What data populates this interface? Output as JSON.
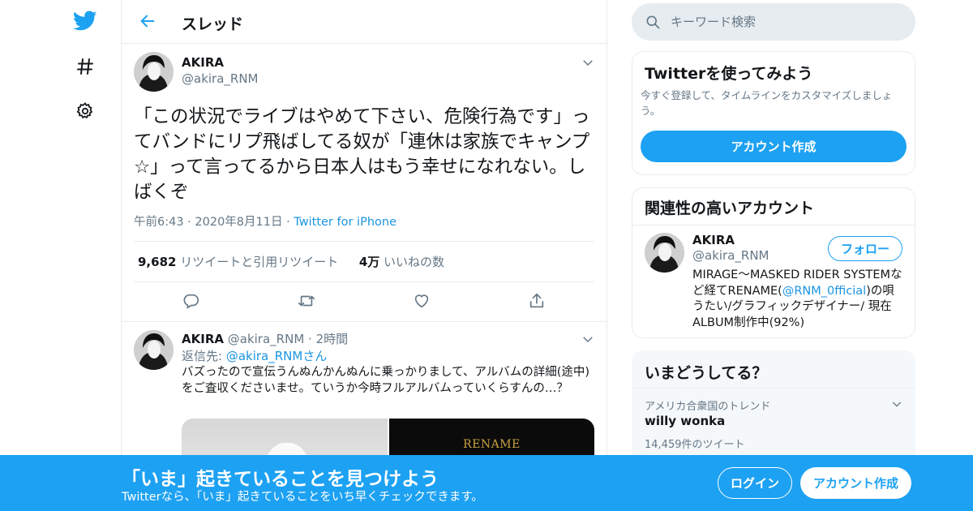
{
  "nav": {
    "items": [
      {
        "icon": "twitter-bird-icon"
      },
      {
        "icon": "hashtag-icon"
      },
      {
        "icon": "gear-icon"
      }
    ]
  },
  "header": {
    "title": "スレッド"
  },
  "tweet": {
    "name": "AKIRA",
    "handle": "@akira_RNM",
    "text": "「この状況でライブはやめて下さい、危険行為です」ってバンドにリプ飛ばしてる奴が「連休は家族でキャンプ☆」って言ってるから日本人はもう幸せになれない。しばくぞ",
    "time": "午前6:43",
    "date": "2020年8月11日",
    "source": "Twitter for iPhone",
    "retweets_count": "9,682",
    "retweets_label": "リツイートと引用リツイート",
    "likes_count": "4万",
    "likes_label": "いいねの数"
  },
  "reply": {
    "name": "AKIRA",
    "handle": "@akira_RNM",
    "time": "2時間",
    "reply_to_prefix": "返信先: ",
    "reply_to_handle": "@akira_RNM",
    "reply_to_suffix": "さん",
    "text": "バズったので宣伝うんぬんかんぬんに乗っかりまして、アルバムの詳細(途中)をご査収くださいませ。ていうか今時フルアルバムっていくらすんの…？",
    "media_title": "RENAME"
  },
  "search": {
    "placeholder": "キーワード検索"
  },
  "signup_card": {
    "title": "Twitterを使ってみよう",
    "desc": "今すぐ登録して、タイムラインをカスタマイズしましょう。",
    "button": "アカウント作成"
  },
  "related": {
    "title": "関連性の高いアカウント",
    "name": "AKIRA",
    "handle": "@akira_RNM",
    "follow": "フォロー",
    "bio_pre": "MIRAGE〜MASKED RIDER SYSTEMなど経てRENAME(",
    "bio_link": "@RNM_0fficial",
    "bio_post": ")の唄うたい/グラフィックデザイナー/ 現在ALBUM制作中(92%)"
  },
  "trends": {
    "title": "いまどうしてる？",
    "context": "アメリカ合衆国のトレンド",
    "name": "willy wonka",
    "count": "14,459件のツイート"
  },
  "banner": {
    "title": "「いま」起きていることを見つけよう",
    "subtitle": "Twitterなら、「いま」起きていることをいち早くチェックできます。",
    "login": "ログイン",
    "signup": "アカウント作成"
  },
  "colors": {
    "accent": "#1da1f2",
    "link": "#1b95e0",
    "muted": "#657786",
    "border": "#e6ecf0"
  }
}
